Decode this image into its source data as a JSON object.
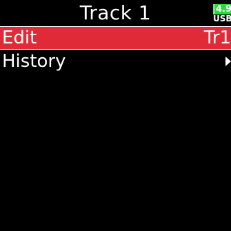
{
  "header": {
    "title": "Track 1",
    "battery_level": "4.9",
    "power_source": "USB"
  },
  "menu": {
    "items": [
      {
        "label": "Edit",
        "value": "Tr1",
        "selected": true
      },
      {
        "label": "History",
        "icon": "chevron-right-icon",
        "selected": false
      }
    ]
  },
  "colors": {
    "background": "#000000",
    "selection": "#e12a37",
    "battery": "#2bd83f",
    "text": "#ffffff"
  }
}
